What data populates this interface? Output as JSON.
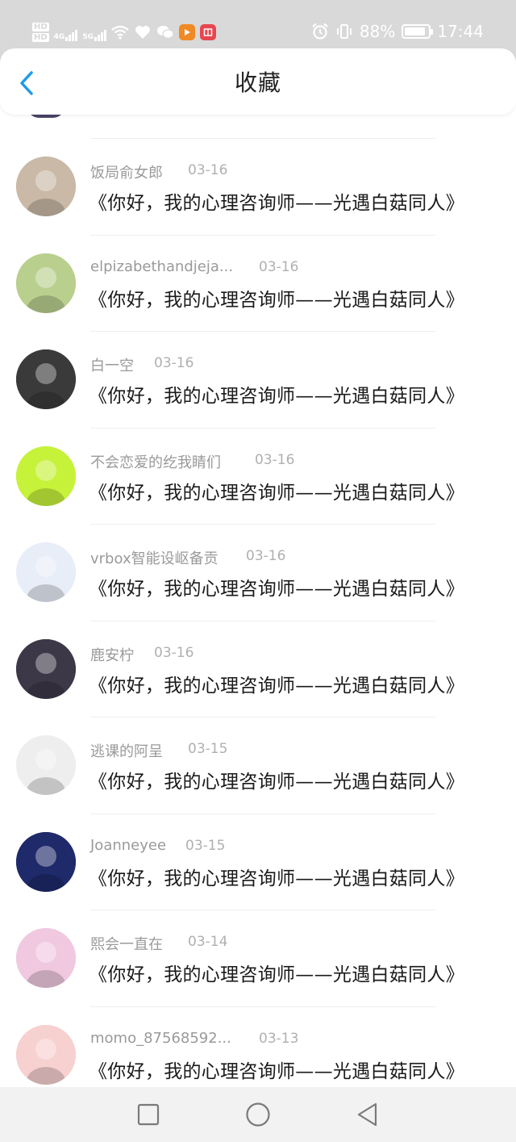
{
  "status_bar": {
    "sim1": "HD",
    "sim2": "HD",
    "net1": "4G",
    "net2": "5G",
    "battery": "88%",
    "battery_level": 0.88,
    "time": "17:44"
  },
  "header": {
    "title": "收藏"
  },
  "favorites": [
    {
      "name": "饭局俞女郎",
      "date": "03-16",
      "content": "《你好，我的心理咨询师——光遇白菇同人》",
      "avatar_color": "#c9b9a6"
    },
    {
      "name": "elpizabethandjeja...",
      "date": "03-16",
      "content": "《你好，我的心理咨询师——光遇白菇同人》",
      "avatar_color": "#b9cf8e"
    },
    {
      "name": "白一空",
      "date": "03-16",
      "content": "《你好，我的心理咨询师——光遇白菇同人》",
      "avatar_color": "#3a3a3a"
    },
    {
      "name": "不会恋爱的纥我睛们",
      "date": "03-16",
      "content": "《你好，我的心理咨询师——光遇白菇同人》",
      "avatar_color": "#c6f23a"
    },
    {
      "name": "vrbox智能设岖备贡",
      "date": "03-16",
      "content": "《你好，我的心理咨询师——光遇白菇同人》",
      "avatar_color": "#e8eef8"
    },
    {
      "name": "鹿安柠",
      "date": "03-16",
      "content": "《你好，我的心理咨询师——光遇白菇同人》",
      "avatar_color": "#3d3848"
    },
    {
      "name": "逃课的阿呈",
      "date": "03-15",
      "content": "《你好，我的心理咨询师——光遇白菇同人》",
      "avatar_color": "#eeeeee"
    },
    {
      "name": "Joanneyee",
      "date": "03-15",
      "content": "《你好，我的心理咨询师——光遇白菇同人》",
      "avatar_color": "#1f2a6b"
    },
    {
      "name": "熙会一直在",
      "date": "03-14",
      "content": "《你好，我的心理咨询师——光遇白菇同人》",
      "avatar_color": "#f0c8e0"
    },
    {
      "name": "momo_87568592...",
      "date": "03-13",
      "content": "《你好，我的心理咨询师——光遇白菇同人》",
      "avatar_color": "#f7d0d0"
    }
  ],
  "colors": {
    "accent": "#1e9be8",
    "status_bar_bg": "#d9d9d9",
    "nav_bar_bg": "#f2f2f2"
  },
  "icons": {
    "back": "chevron-left-icon",
    "nav_recent": "square-icon",
    "nav_home": "circle-icon",
    "nav_back": "triangle-back-icon"
  }
}
